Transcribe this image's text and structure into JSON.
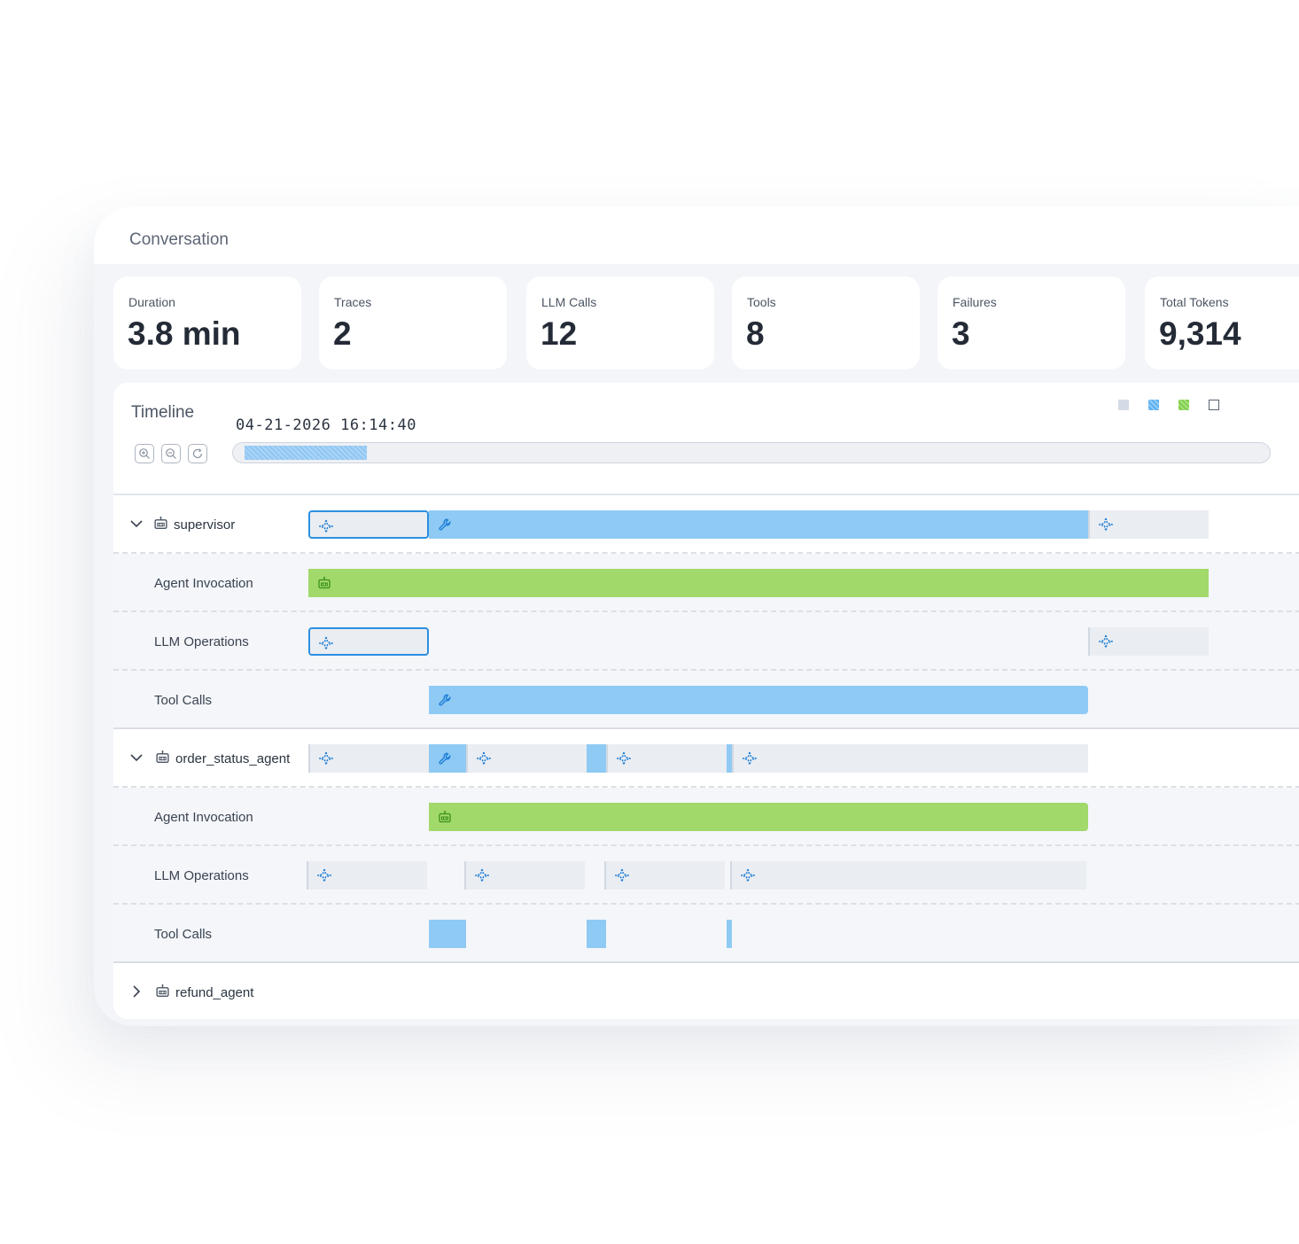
{
  "header": {
    "title": "Conversation"
  },
  "stats": [
    {
      "label": "Duration",
      "value": "3.8 min"
    },
    {
      "label": "Traces",
      "value": "2"
    },
    {
      "label": "LLM Calls",
      "value": "12"
    },
    {
      "label": "Tools",
      "value": "8"
    },
    {
      "label": "Failures",
      "value": "3"
    },
    {
      "label": "Total Tokens",
      "value": "9,314"
    }
  ],
  "timeline": {
    "title": "Timeline",
    "timestamp": "04-21-2026 16:14:40",
    "controls": [
      "zoom-in-icon",
      "zoom-out-icon",
      "reset-icon"
    ],
    "legend_colors": [
      "#d4dbe6",
      "#5bb0f0",
      "#7ccf45",
      "#ffffff"
    ],
    "colors": {
      "llm": "#eaedf2",
      "tool": "#8fcaf4",
      "invocation": "#a1d96a",
      "selected": "#2d8fe0"
    }
  },
  "agents": [
    {
      "name": "supervisor",
      "expanded": true,
      "rows": {
        "invocation": "Agent Invocation",
        "llm": "LLM Operations",
        "tools": "Tool Calls"
      }
    },
    {
      "name": "order_status_agent",
      "expanded": true,
      "rows": {
        "invocation": "Agent Invocation",
        "llm": "LLM Operations",
        "tools": "Tool Calls"
      }
    },
    {
      "name": "refund_agent",
      "expanded": false
    }
  ]
}
